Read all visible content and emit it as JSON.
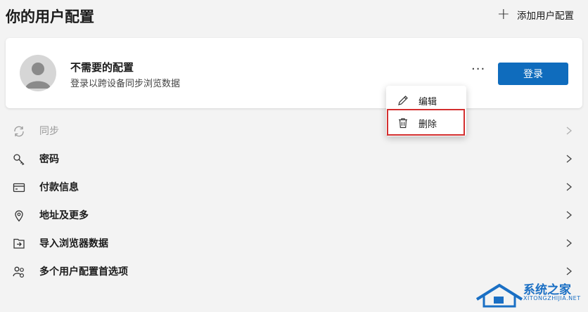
{
  "header": {
    "title": "你的用户配置",
    "add_profile_label": "添加用户配置"
  },
  "profile_card": {
    "name": "不需要的配置",
    "subtitle": "登录以跨设备同步浏览数据",
    "more_label": "···",
    "signin_label": "登录"
  },
  "context_menu": {
    "items": [
      {
        "label": "编辑",
        "icon": "pencil-icon"
      },
      {
        "label": "删除",
        "icon": "trash-icon"
      }
    ],
    "highlight_color": "#d32f2f"
  },
  "settings_list": {
    "items": [
      {
        "label": "同步",
        "icon": "sync-icon",
        "disabled": true
      },
      {
        "label": "密码",
        "icon": "key-icon"
      },
      {
        "label": "付款信息",
        "icon": "card-icon"
      },
      {
        "label": "地址及更多",
        "icon": "location-pin-icon"
      },
      {
        "label": "导入浏览器数据",
        "icon": "import-icon"
      },
      {
        "label": "多个用户配置首选项",
        "icon": "people-settings-icon"
      }
    ]
  },
  "watermark": {
    "text": "系统之家",
    "subtext": "XITONGZHIJIA.NET"
  },
  "colors": {
    "accent": "#0f6cbd",
    "background": "#f3f3f3"
  }
}
